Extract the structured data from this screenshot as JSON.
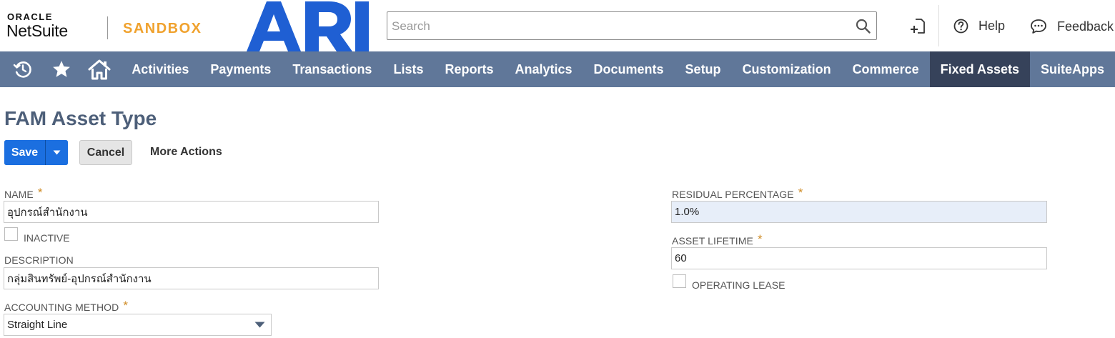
{
  "header": {
    "oracle": "ORACLE",
    "netsuite": "NetSuite",
    "sandbox": "SANDBOX",
    "search_placeholder": "Search",
    "help": "Help",
    "feedback": "Feedback",
    "brand_color": "#1b6fe0"
  },
  "nav": {
    "items": [
      "Activities",
      "Payments",
      "Transactions",
      "Lists",
      "Reports",
      "Analytics",
      "Documents",
      "Setup",
      "Customization",
      "Commerce",
      "Fixed Assets",
      "SuiteApps"
    ],
    "active": "Fixed Assets",
    "bar_color": "#607799",
    "active_color": "#36425a"
  },
  "page": {
    "title": "FAM Asset Type"
  },
  "actions": {
    "save": "Save",
    "cancel": "Cancel",
    "more": "More Actions"
  },
  "form": {
    "name_label": "NAME",
    "name_value": "อุปกรณ์สำนักงาน",
    "inactive_label": "INACTIVE",
    "description_label": "DESCRIPTION",
    "description_value": "กลุ่มสินทรัพย์-อุปกรณ์สำนักงาน",
    "method_label": "ACCOUNTING METHOD",
    "method_value": "Straight Line",
    "residual_label": "RESIDUAL PERCENTAGE",
    "residual_value": "1.0%",
    "lifetime_label": "ASSET LIFETIME",
    "lifetime_value": "60",
    "lease_label": "OPERATING LEASE",
    "required_mark": "*"
  }
}
